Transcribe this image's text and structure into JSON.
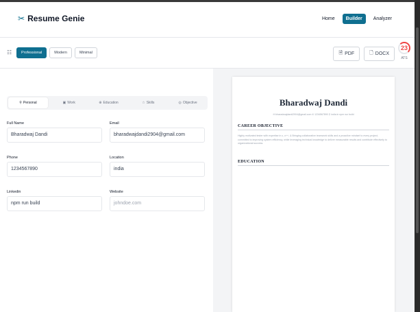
{
  "nav": {
    "logo_glyph": "✂",
    "brand": "Resume Genie",
    "links": [
      "Home",
      "Builder",
      "Analyzer"
    ],
    "active_link": "Builder"
  },
  "toolbar": {
    "templates": [
      "Professional",
      "Modern",
      "Minimal"
    ],
    "active_template": "Professional",
    "pdf_label": "PDF",
    "docx_label": "DOCX",
    "ats_score": "23",
    "ats_label": "ATS"
  },
  "tabs": [
    {
      "icon": "⚲",
      "label": "Personal"
    },
    {
      "icon": "▣",
      "label": "Work"
    },
    {
      "icon": "⊕",
      "label": "Education"
    },
    {
      "icon": "☆",
      "label": "Skills"
    },
    {
      "icon": "◎",
      "label": "Objective"
    }
  ],
  "form": {
    "full_name": {
      "label": "Full Name",
      "value": "Bharadwaj Dandi"
    },
    "email": {
      "label": "Email",
      "value": "bharadwajdandi2904@gmail.com"
    },
    "phone": {
      "label": "Phone",
      "value": "1234567890"
    },
    "location": {
      "label": "Location",
      "value": "india"
    },
    "linkedin": {
      "label": "Linkedin",
      "value": "npm run build"
    },
    "website": {
      "label": "Website",
      "placeholder": "johndoe.com"
    }
  },
  "preview": {
    "name": "Bharadwaj Dandi",
    "contact": "✉ bharadwajdandi2904@gmail.com   ✆ 1234567890   ⚲ india   in npm run build",
    "career_heading": "CAREER OBJECTIVE",
    "career_text": "Highly motivated tester with expertise in c, c++, & Bringing collaborative teamwork skills and a proactive mindset to every project, committed to improving system efficiency, while leveraging technical knowledge to deliver measurable results and contribute effectively to organizational success.",
    "education_heading": "EDUCATION"
  }
}
